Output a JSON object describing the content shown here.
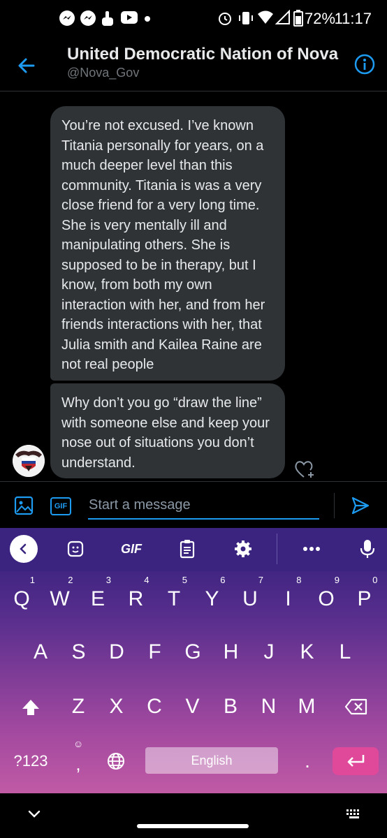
{
  "status_bar": {
    "battery_percent": "72%",
    "time": "11:17"
  },
  "header": {
    "title": "United Democratic Nation of Nova",
    "handle": "@Nova_Gov"
  },
  "messages": [
    {
      "text": "You’re not excused. I’ve known Titania personally for years, on a much deeper level than this community. Titania is was a very close friend for a very long time. She is very mentally ill and manipulating others. She is supposed to be in therapy, but I know, from both my own interaction with her, and from her friends interactions with her, that Julia smith and Kailea Raine are not real people"
    },
    {
      "text": "Why don’t you go “draw the line” with someone else and keep your nose out of situations you don’t understand."
    }
  ],
  "composer": {
    "gif_label": "GIF",
    "placeholder": "Start a message"
  },
  "keyboard": {
    "toolbar_gif": "GIF",
    "row1": [
      {
        "key": "Q",
        "hint": "1"
      },
      {
        "key": "W",
        "hint": "2"
      },
      {
        "key": "E",
        "hint": "3"
      },
      {
        "key": "R",
        "hint": "4"
      },
      {
        "key": "T",
        "hint": "5"
      },
      {
        "key": "Y",
        "hint": "6"
      },
      {
        "key": "U",
        "hint": "7"
      },
      {
        "key": "I",
        "hint": "8"
      },
      {
        "key": "O",
        "hint": "9"
      },
      {
        "key": "P",
        "hint": "0"
      }
    ],
    "row2": [
      "A",
      "S",
      "D",
      "F",
      "G",
      "H",
      "J",
      "K",
      "L"
    ],
    "row3": [
      "Z",
      "X",
      "C",
      "V",
      "B",
      "N",
      "M"
    ],
    "symbols_key": "?123",
    "comma_key": ",",
    "period_key": ".",
    "space_label": "English",
    "accent_color": "#e0489a"
  },
  "icons": {
    "status": [
      "messenger-icon",
      "messenger-icon",
      "hand-icon",
      "youtube-icon",
      "dot-icon",
      "alarm-icon",
      "vibrate-icon",
      "wifi-icon",
      "signal-icon",
      "battery-icon"
    ],
    "header": [
      "back-arrow-icon",
      "info-icon"
    ],
    "composer": [
      "image-icon",
      "gif-icon",
      "send-icon"
    ],
    "keyboard_toolbar": [
      "chevron-left-icon",
      "sticker-icon",
      "gif-icon",
      "clipboard-icon",
      "gear-icon",
      "more-icon",
      "mic-icon"
    ]
  }
}
